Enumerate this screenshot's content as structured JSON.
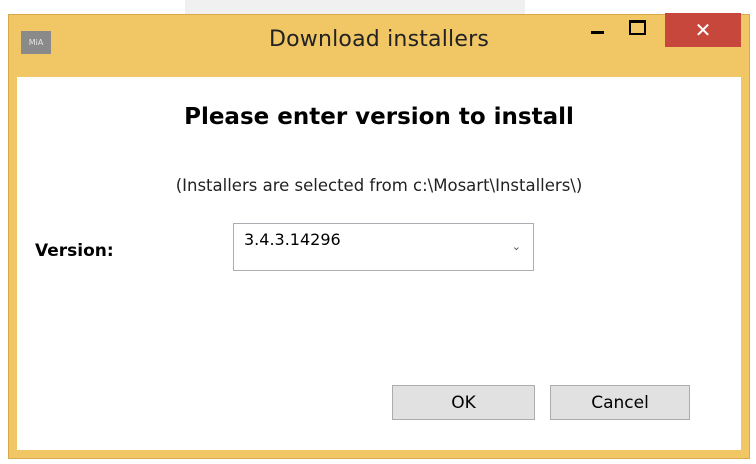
{
  "window": {
    "title": "Download installers",
    "app_icon_text": "MiA",
    "controls": {
      "minimize": "minimize-icon",
      "maximize": "maximize-icon",
      "close": "close-icon",
      "close_glyph": "✕"
    },
    "colors": {
      "frame": "#f1c664",
      "close_button": "#c7473c"
    }
  },
  "dialog": {
    "heading": "Please enter version to install",
    "subtext": "(Installers are selected from c:\\Mosart\\Installers\\)",
    "version_label": "Version:",
    "version_value": "3.4.3.14296",
    "dropdown_arrow": "⌄",
    "ok_label": "OK",
    "cancel_label": "Cancel"
  }
}
